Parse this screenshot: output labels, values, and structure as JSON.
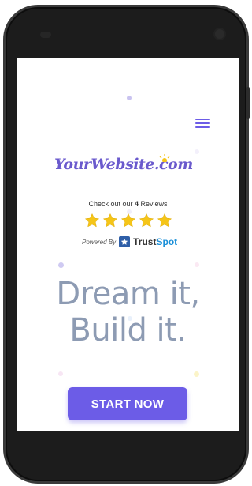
{
  "site": {
    "logo_text": "YourWebsite.com"
  },
  "reviews": {
    "prefix": "Check out our ",
    "count": "4",
    "suffix": " Reviews",
    "rating": 5,
    "max_rating": 5
  },
  "trustspot": {
    "powered_by": "Powered By",
    "brand_trust": "Trust",
    "brand_spot": "Spot"
  },
  "hero": {
    "line1": "Dream it,",
    "line2": "Build it."
  },
  "cta": {
    "label": "START NOW"
  },
  "colors": {
    "accent": "#6c5ce7",
    "star": "#f5c518",
    "hero_text": "#7a8aa6",
    "trustspot_blue": "#1a8fd8"
  },
  "icons": {
    "menu": "hamburger-menu-icon",
    "star": "star-icon",
    "trustspot": "trustspot-star-icon"
  }
}
